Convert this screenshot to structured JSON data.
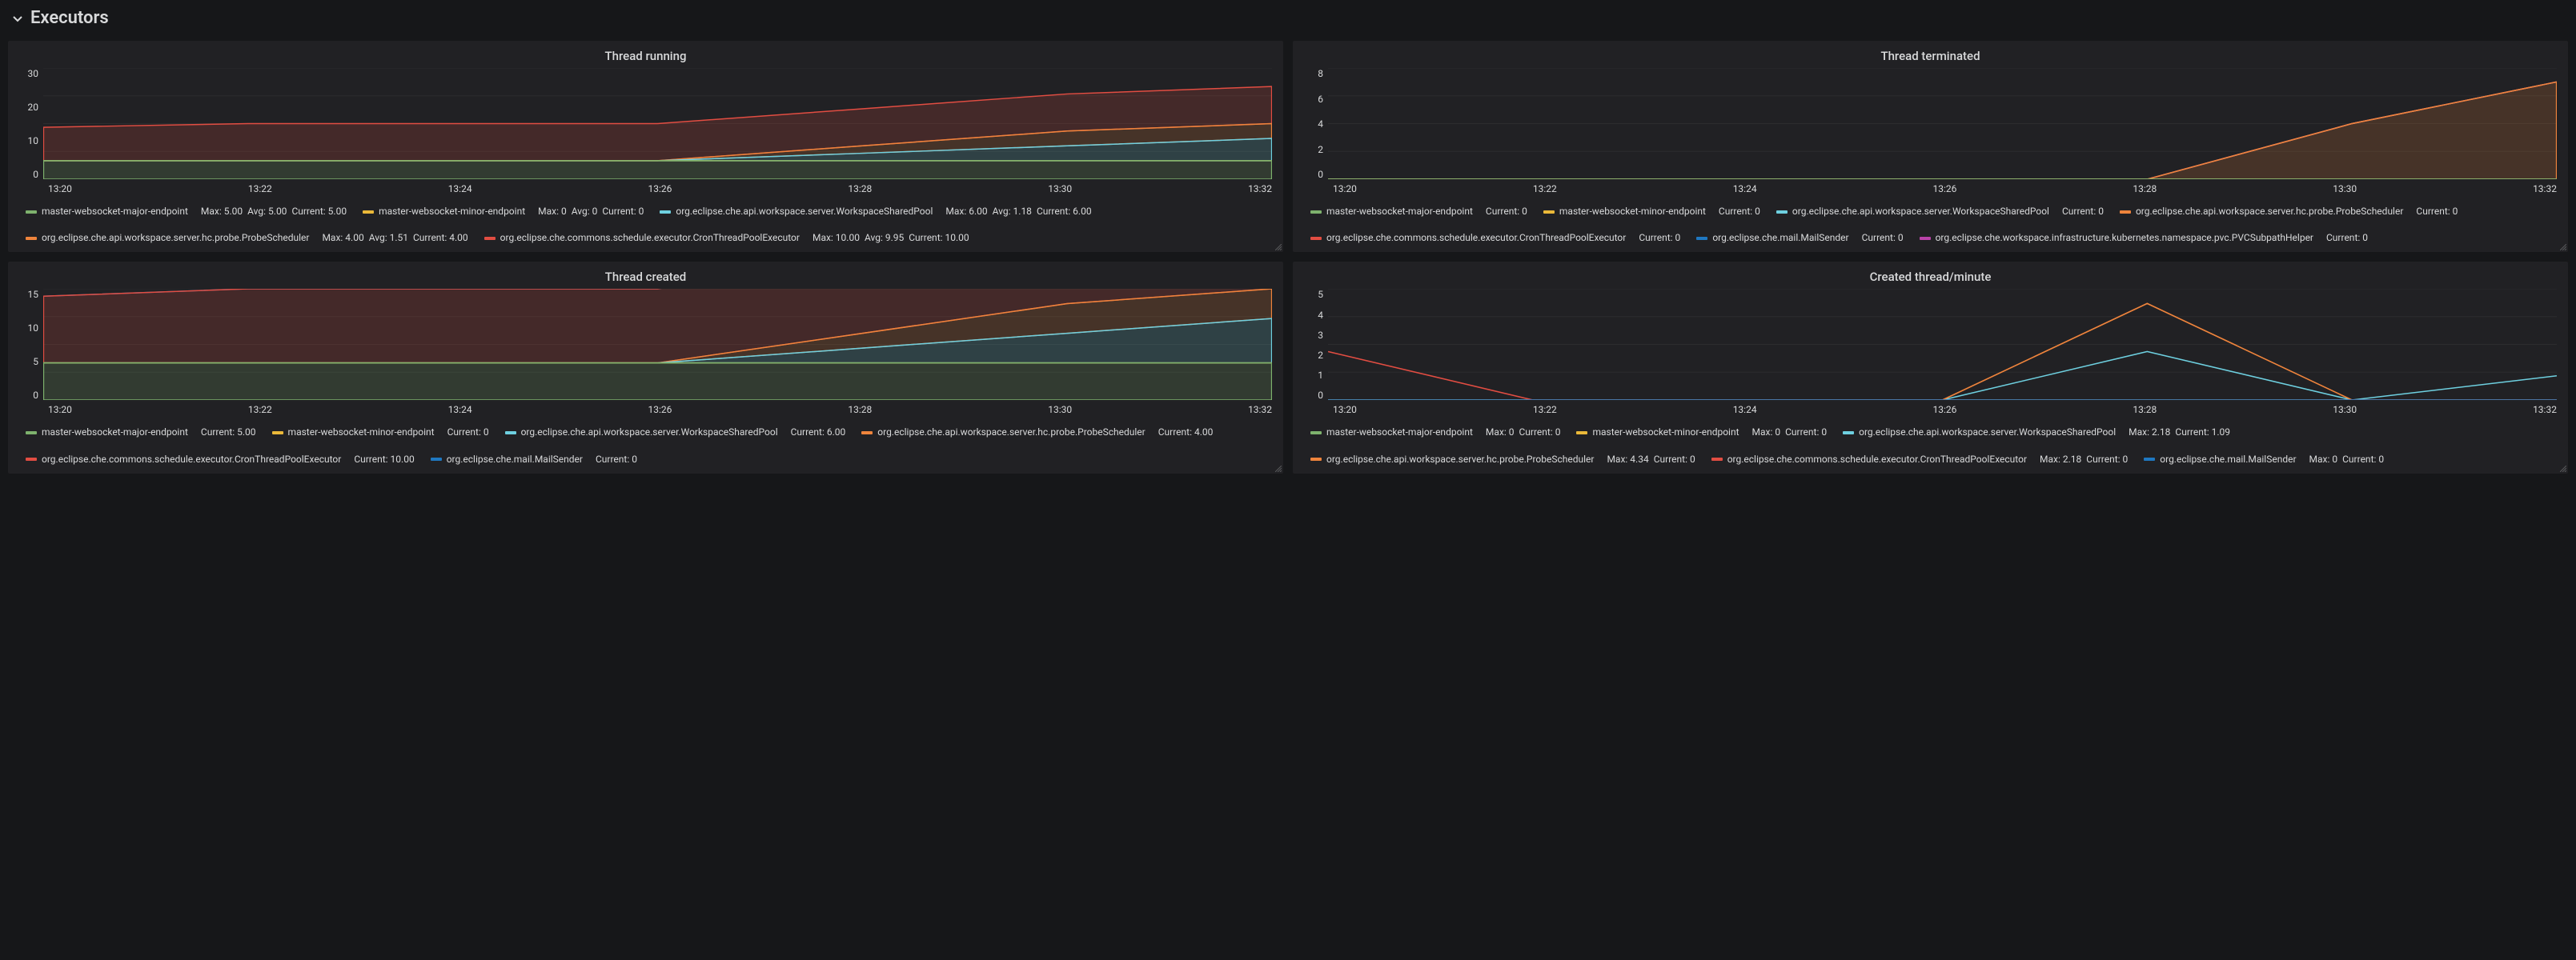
{
  "section": {
    "title": "Executors"
  },
  "time_ticks": [
    "13:20",
    "13:22",
    "13:24",
    "13:26",
    "13:28",
    "13:30",
    "13:32"
  ],
  "colors": {
    "green": "#7eb26d",
    "yellow": "#eab839",
    "cyan": "#6ed0e0",
    "orange": "#ef843c",
    "red": "#e24d42",
    "blue": "#1f78c1",
    "magenta": "#ba43a9"
  },
  "panels": [
    {
      "id": "thread-running",
      "title": "Thread running",
      "y_ticks": [
        "30",
        "20",
        "10",
        "0"
      ],
      "series": [
        {
          "colorKey": "green",
          "name": "master-websocket-major-endpoint",
          "stats": [
            [
              "Max",
              "5.00"
            ],
            [
              "Avg",
              "5.00"
            ],
            [
              "Current",
              "5.00"
            ]
          ]
        },
        {
          "colorKey": "yellow",
          "name": "master-websocket-minor-endpoint",
          "stats": [
            [
              "Max",
              "0"
            ],
            [
              "Avg",
              "0"
            ],
            [
              "Current",
              "0"
            ]
          ]
        },
        {
          "colorKey": "cyan",
          "name": "org.eclipse.che.api.workspace.server.WorkspaceSharedPool",
          "stats": [
            [
              "Max",
              "6.00"
            ],
            [
              "Avg",
              "1.18"
            ],
            [
              "Current",
              "6.00"
            ]
          ]
        },
        {
          "colorKey": "orange",
          "name": "org.eclipse.che.api.workspace.server.hc.probe.ProbeScheduler",
          "stats": [
            [
              "Max",
              "4.00"
            ],
            [
              "Avg",
              "1.51"
            ],
            [
              "Current",
              "4.00"
            ]
          ]
        },
        {
          "colorKey": "red",
          "name": "org.eclipse.che.commons.schedule.executor.CronThreadPoolExecutor",
          "stats": [
            [
              "Max",
              "10.00"
            ],
            [
              "Avg",
              "9.95"
            ],
            [
              "Current",
              "10.00"
            ]
          ]
        }
      ]
    },
    {
      "id": "thread-terminated",
      "title": "Thread terminated",
      "y_ticks": [
        "8",
        "6",
        "4",
        "2",
        "0"
      ],
      "series": [
        {
          "colorKey": "green",
          "name": "master-websocket-major-endpoint",
          "stats": [
            [
              "Current",
              "0"
            ]
          ]
        },
        {
          "colorKey": "yellow",
          "name": "master-websocket-minor-endpoint",
          "stats": [
            [
              "Current",
              "0"
            ]
          ]
        },
        {
          "colorKey": "cyan",
          "name": "org.eclipse.che.api.workspace.server.WorkspaceSharedPool",
          "stats": [
            [
              "Current",
              "0"
            ]
          ]
        },
        {
          "colorKey": "orange",
          "name": "org.eclipse.che.api.workspace.server.hc.probe.ProbeScheduler",
          "stats": [
            [
              "Current",
              "0"
            ]
          ]
        },
        {
          "colorKey": "red",
          "name": "org.eclipse.che.commons.schedule.executor.CronThreadPoolExecutor",
          "stats": [
            [
              "Current",
              "0"
            ]
          ]
        },
        {
          "colorKey": "blue",
          "name": "org.eclipse.che.mail.MailSender",
          "stats": [
            [
              "Current",
              "0"
            ]
          ]
        },
        {
          "colorKey": "magenta",
          "name": "org.eclipse.che.workspace.infrastructure.kubernetes.namespace.pvc.PVCSubpathHelper",
          "stats": [
            [
              "Current",
              "0"
            ]
          ]
        }
      ]
    },
    {
      "id": "thread-created",
      "title": "Thread created",
      "y_ticks": [
        "15",
        "10",
        "5",
        "0"
      ],
      "series": [
        {
          "colorKey": "green",
          "name": "master-websocket-major-endpoint",
          "stats": [
            [
              "Current",
              "5.00"
            ]
          ]
        },
        {
          "colorKey": "yellow",
          "name": "master-websocket-minor-endpoint",
          "stats": [
            [
              "Current",
              "0"
            ]
          ]
        },
        {
          "colorKey": "cyan",
          "name": "org.eclipse.che.api.workspace.server.WorkspaceSharedPool",
          "stats": [
            [
              "Current",
              "6.00"
            ]
          ]
        },
        {
          "colorKey": "orange",
          "name": "org.eclipse.che.api.workspace.server.hc.probe.ProbeScheduler",
          "stats": [
            [
              "Current",
              "4.00"
            ]
          ]
        },
        {
          "colorKey": "red",
          "name": "org.eclipse.che.commons.schedule.executor.CronThreadPoolExecutor",
          "stats": [
            [
              "Current",
              "10.00"
            ]
          ]
        },
        {
          "colorKey": "blue",
          "name": "org.eclipse.che.mail.MailSender",
          "stats": [
            [
              "Current",
              "0"
            ]
          ]
        }
      ]
    },
    {
      "id": "created-thread-per-minute",
      "title": "Created thread/minute",
      "y_ticks": [
        "5",
        "4",
        "3",
        "2",
        "1",
        "0"
      ],
      "series": [
        {
          "colorKey": "green",
          "name": "master-websocket-major-endpoint",
          "stats": [
            [
              "Max",
              "0"
            ],
            [
              "Current",
              "0"
            ]
          ]
        },
        {
          "colorKey": "yellow",
          "name": "master-websocket-minor-endpoint",
          "stats": [
            [
              "Max",
              "0"
            ],
            [
              "Current",
              "0"
            ]
          ]
        },
        {
          "colorKey": "cyan",
          "name": "org.eclipse.che.api.workspace.server.WorkspaceSharedPool",
          "stats": [
            [
              "Max",
              "2.18"
            ],
            [
              "Current",
              "1.09"
            ]
          ]
        },
        {
          "colorKey": "orange",
          "name": "org.eclipse.che.api.workspace.server.hc.probe.ProbeScheduler",
          "stats": [
            [
              "Max",
              "4.34"
            ],
            [
              "Current",
              "0"
            ]
          ]
        },
        {
          "colorKey": "red",
          "name": "org.eclipse.che.commons.schedule.executor.CronThreadPoolExecutor",
          "stats": [
            [
              "Max",
              "2.18"
            ],
            [
              "Current",
              "0"
            ]
          ]
        },
        {
          "colorKey": "blue",
          "name": "org.eclipse.che.mail.MailSender",
          "stats": [
            [
              "Max",
              "0"
            ],
            [
              "Current",
              "0"
            ]
          ]
        }
      ]
    }
  ],
  "chart_data": [
    {
      "title": "Thread running",
      "type": "area",
      "xlabel": "",
      "ylabel": "",
      "x": [
        "13:20",
        "13:22",
        "13:24",
        "13:26",
        "13:28",
        "13:30",
        "13:32"
      ],
      "ylim": [
        0,
        30
      ],
      "series": [
        {
          "name": "master-websocket-major-endpoint",
          "values": [
            5,
            5,
            5,
            5,
            5,
            5,
            5
          ]
        },
        {
          "name": "master-websocket-minor-endpoint",
          "values": [
            0,
            0,
            0,
            0,
            0,
            0,
            0
          ]
        },
        {
          "name": "org.eclipse.che.api.workspace.server.WorkspaceSharedPool",
          "values": [
            0,
            0,
            0,
            0,
            2,
            4,
            6
          ]
        },
        {
          "name": "org.eclipse.che.api.workspace.server.hc.probe.ProbeScheduler",
          "values": [
            0,
            0,
            0,
            0,
            2,
            4,
            4
          ]
        },
        {
          "name": "org.eclipse.che.commons.schedule.executor.CronThreadPoolExecutor",
          "values": [
            9,
            10,
            10,
            10,
            10,
            10,
            10
          ]
        }
      ]
    },
    {
      "title": "Thread terminated",
      "type": "area",
      "xlabel": "",
      "ylabel": "",
      "x": [
        "13:20",
        "13:22",
        "13:24",
        "13:26",
        "13:28",
        "13:30",
        "13:32"
      ],
      "ylim": [
        0,
        8
      ],
      "series": [
        {
          "name": "master-websocket-major-endpoint",
          "values": [
            0,
            0,
            0,
            0,
            0,
            0,
            0
          ]
        },
        {
          "name": "master-websocket-minor-endpoint",
          "values": [
            0,
            0,
            0,
            0,
            0,
            0,
            0
          ]
        },
        {
          "name": "org.eclipse.che.api.workspace.server.WorkspaceSharedPool",
          "values": [
            0,
            0,
            0,
            0,
            0,
            0,
            0
          ]
        },
        {
          "name": "org.eclipse.che.api.workspace.server.hc.probe.ProbeScheduler",
          "values": [
            0,
            0,
            0,
            0,
            0,
            4,
            7
          ]
        },
        {
          "name": "org.eclipse.che.commons.schedule.executor.CronThreadPoolExecutor",
          "values": [
            0,
            0,
            0,
            0,
            0,
            0,
            0
          ]
        },
        {
          "name": "org.eclipse.che.mail.MailSender",
          "values": [
            0,
            0,
            0,
            0,
            0,
            0,
            0
          ]
        },
        {
          "name": "org.eclipse.che.workspace.infrastructure.kubernetes.namespace.pvc.PVCSubpathHelper",
          "values": [
            0,
            0,
            0,
            0,
            0,
            0,
            0
          ]
        }
      ]
    },
    {
      "title": "Thread created",
      "type": "area",
      "xlabel": "",
      "ylabel": "",
      "x": [
        "13:20",
        "13:22",
        "13:24",
        "13:26",
        "13:28",
        "13:30",
        "13:32"
      ],
      "ylim": [
        0,
        15
      ],
      "series": [
        {
          "name": "master-websocket-major-endpoint",
          "values": [
            5,
            5,
            5,
            5,
            5,
            5,
            5
          ]
        },
        {
          "name": "master-websocket-minor-endpoint",
          "values": [
            0,
            0,
            0,
            0,
            0,
            0,
            0
          ]
        },
        {
          "name": "org.eclipse.che.api.workspace.server.WorkspaceSharedPool",
          "values": [
            0,
            0,
            0,
            0,
            2,
            4,
            6
          ]
        },
        {
          "name": "org.eclipse.che.api.workspace.server.hc.probe.ProbeScheduler",
          "values": [
            0,
            0,
            0,
            0,
            2,
            4,
            4
          ]
        },
        {
          "name": "org.eclipse.che.commons.schedule.executor.CronThreadPoolExecutor",
          "values": [
            9,
            10,
            10,
            10,
            10,
            10,
            10
          ]
        },
        {
          "name": "org.eclipse.che.mail.MailSender",
          "values": [
            0,
            0,
            0,
            0,
            0,
            0,
            0
          ]
        }
      ]
    },
    {
      "title": "Created thread/minute",
      "type": "line",
      "xlabel": "",
      "ylabel": "",
      "x": [
        "13:20",
        "13:22",
        "13:24",
        "13:26",
        "13:28",
        "13:30",
        "13:32"
      ],
      "ylim": [
        0,
        5
      ],
      "series": [
        {
          "name": "master-websocket-major-endpoint",
          "values": [
            0,
            0,
            0,
            0,
            0,
            0,
            0
          ]
        },
        {
          "name": "master-websocket-minor-endpoint",
          "values": [
            0,
            0,
            0,
            0,
            0,
            0,
            0
          ]
        },
        {
          "name": "org.eclipse.che.api.workspace.server.WorkspaceSharedPool",
          "values": [
            0,
            0,
            0,
            0,
            2.18,
            0,
            1.09
          ]
        },
        {
          "name": "org.eclipse.che.api.workspace.server.hc.probe.ProbeScheduler",
          "values": [
            0,
            0,
            0,
            0,
            4.34,
            0,
            0
          ]
        },
        {
          "name": "org.eclipse.che.commons.schedule.executor.CronThreadPoolExecutor",
          "values": [
            2.18,
            0,
            0,
            0,
            0,
            0,
            0
          ]
        },
        {
          "name": "org.eclipse.che.mail.MailSender",
          "values": [
            0,
            0,
            0,
            0,
            0,
            0,
            0
          ]
        }
      ]
    }
  ]
}
